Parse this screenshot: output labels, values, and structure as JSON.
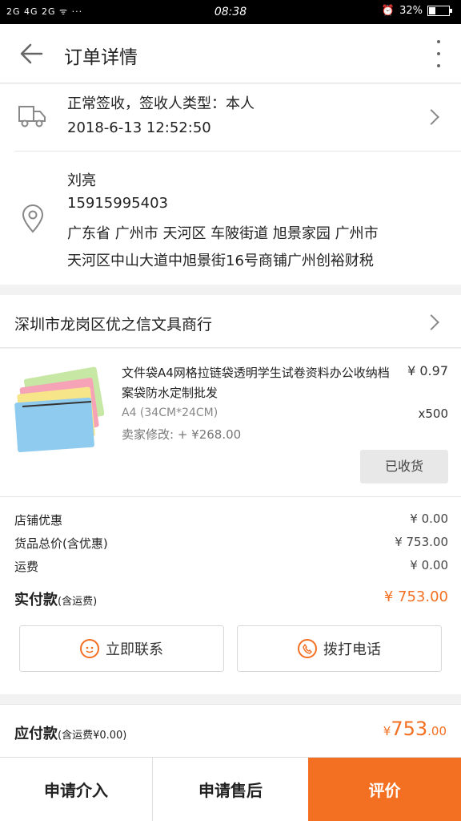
{
  "status_bar": {
    "signal": "2G 4G 2G ᯤ ···",
    "time": "08:38",
    "battery_percent": "32%"
  },
  "header": {
    "title": "订单详情"
  },
  "delivery": {
    "status": "正常签收，签收人类型：本人",
    "timestamp": "2018-6-13 12:52:50"
  },
  "address": {
    "name": "刘亮",
    "phone": "15915995403",
    "line1": "广东省 广州市 天河区 车陂街道 旭景家园 广州市",
    "line2": "天河区中山大道中旭景街16号商铺广州创裕财税"
  },
  "shop": {
    "name": "深圳市龙岗区优之信文具商行"
  },
  "product": {
    "name": "文件袋A4网格拉链袋透明学生试卷资料办公收纳档案袋防水定制批发",
    "price": "¥ 0.97",
    "spec": "A4 (34CM*24CM)",
    "quantity": "x500",
    "seller_modified": "卖家修改: + ¥268.00",
    "status_button": "已收货"
  },
  "summary": {
    "rows": [
      {
        "label": "店铺优惠",
        "value": "¥ 0.00"
      },
      {
        "label": "货品总价(含优惠)",
        "value": "¥ 753.00"
      },
      {
        "label": "运费",
        "value": "¥ 0.00"
      }
    ],
    "paid_label": "实付款",
    "paid_note": "(含运费)",
    "paid_value": "¥ 753.00",
    "contact_label": "立即联系",
    "call_label": "拨打电话"
  },
  "payable": {
    "label": "应付款",
    "note": "(含运费¥0.00)",
    "currency": "¥",
    "amount_int": "753",
    "amount_dec": ".00"
  },
  "bottom_bar": {
    "apply_intervene": "申请介入",
    "apply_aftersale": "申请售后",
    "review": "评价"
  },
  "colors": {
    "accent": "#f36f21"
  }
}
